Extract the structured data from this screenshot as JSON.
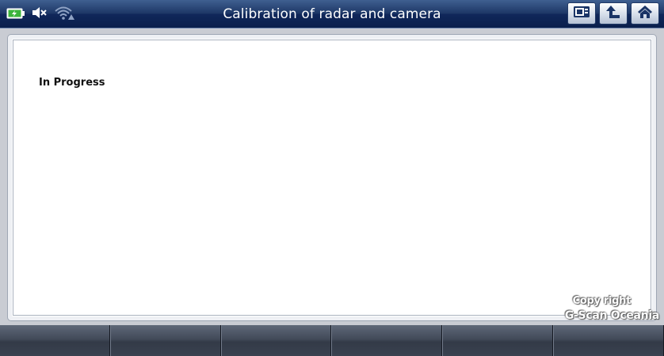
{
  "header": {
    "title": "Calibration of radar and camera",
    "status_icons": [
      "battery-charging-icon",
      "speaker-muted-icon",
      "wifi-warning-icon"
    ],
    "buttons": [
      {
        "name": "screen-capture-button",
        "icon": "screen-capture-icon"
      },
      {
        "name": "back-button",
        "icon": "back-arrow-icon"
      },
      {
        "name": "home-button",
        "icon": "home-icon"
      }
    ]
  },
  "main": {
    "message": "In Progress"
  },
  "function_keys": [
    "",
    "",
    "",
    "",
    "",
    ""
  ],
  "watermark": {
    "line1": "Copy right",
    "line2": "G-Scan Oceania"
  },
  "colors": {
    "title_bar": "#1d3766",
    "function_bar": "#424a59",
    "panel_background": "#ffffff"
  }
}
